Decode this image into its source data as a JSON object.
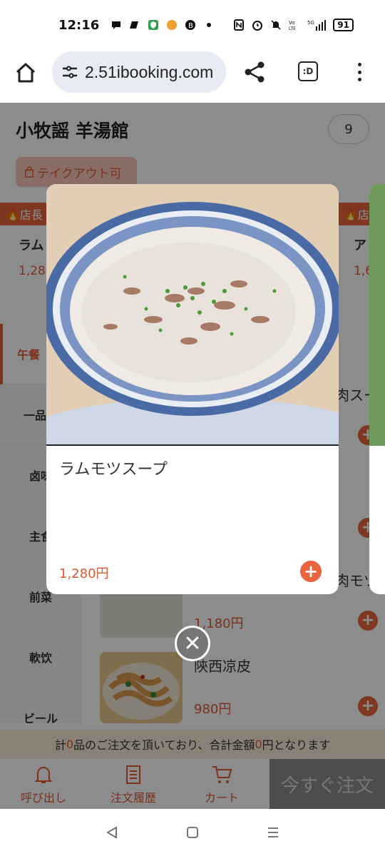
{
  "status_bar": {
    "time": "12:16",
    "battery": "91",
    "network": "5G"
  },
  "browser": {
    "url": "2.51ibooking.com",
    "tab_label": ":D"
  },
  "store": {
    "name": "小牧謡 羊湯館",
    "table_number": "9",
    "takeout": "テイクアウト可"
  },
  "recommend": [
    {
      "tag": "店長",
      "name": "ラム",
      "price": "1,28"
    },
    {
      "tag": "店",
      "name": "ア",
      "price": "1,6"
    }
  ],
  "categories": [
    "午餐",
    "一品料",
    "卤味",
    "主食",
    "前菜",
    "軟饮",
    "ビール"
  ],
  "menu_items": [
    {
      "name": "肉スー",
      "price": ""
    },
    {
      "name": "",
      "price": ""
    },
    {
      "name": "肉モツ",
      "price": "1,180円"
    },
    {
      "name": "陝西凉皮",
      "price": "980円"
    }
  ],
  "summary": {
    "prefix": "計",
    "count": "0",
    "middle": "品のご注文を頂いており、合計金額",
    "amount": "0",
    "suffix": "円となります"
  },
  "bottom_tabs": {
    "call": "呼び出し",
    "history": "注文履歴",
    "cart": "カート",
    "order_now": "今すぐ注文"
  },
  "modal": {
    "name": "ラムモツスープ",
    "price": "1,280円",
    "add": "+"
  },
  "colors": {
    "accent": "#e9643d",
    "price": "#e05a33",
    "summary_bg": "#faecd8"
  }
}
